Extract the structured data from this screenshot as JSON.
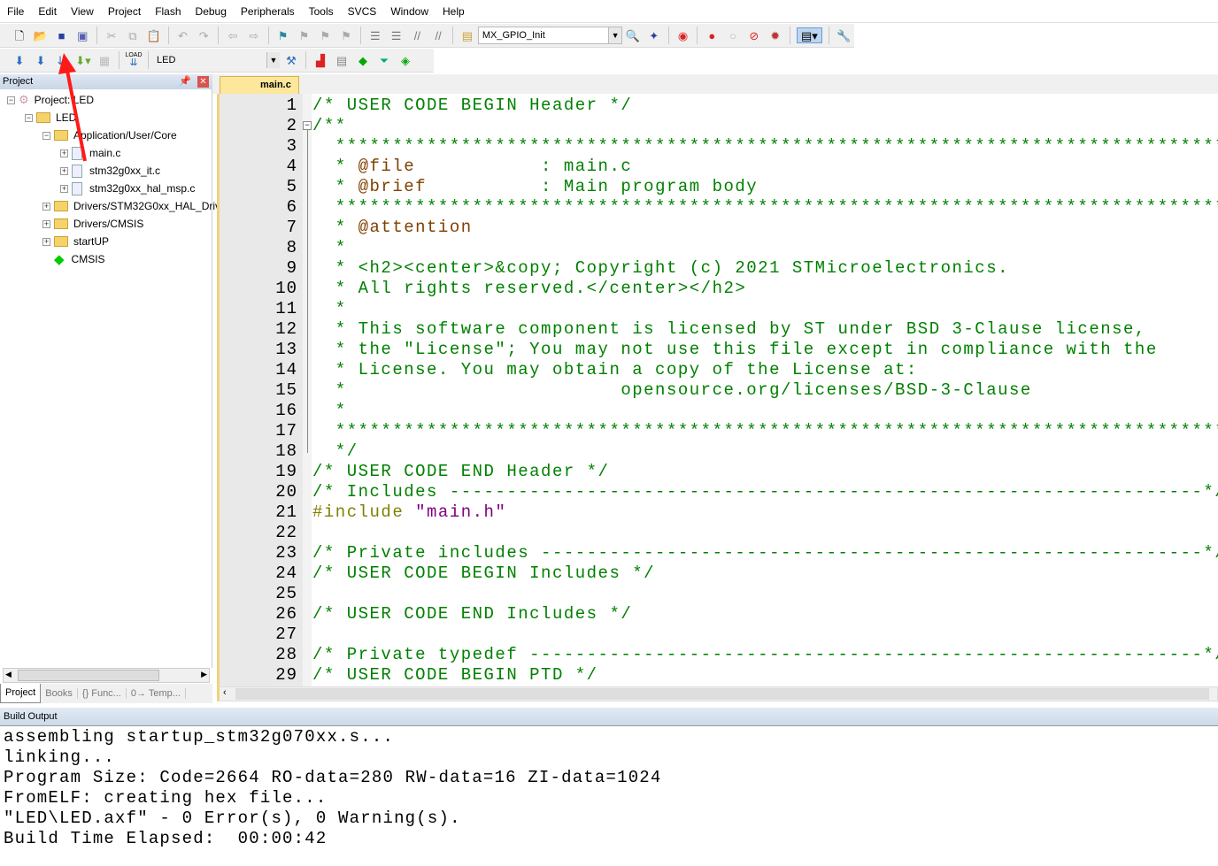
{
  "menu": [
    "File",
    "Edit",
    "View",
    "Project",
    "Flash",
    "Debug",
    "Peripherals",
    "Tools",
    "SVCS",
    "Window",
    "Help"
  ],
  "toolbar1": {
    "target_function": "MX_GPIO_Init"
  },
  "toolbar2": {
    "target_name": "LED",
    "load_label": "LOAD"
  },
  "project_panel": {
    "title": "Project",
    "tree": [
      {
        "label": "Project: LED",
        "level": 0,
        "type": "project",
        "toggle": "−"
      },
      {
        "label": "LED",
        "level": 1,
        "type": "target",
        "toggle": "−"
      },
      {
        "label": "Application/User/Core",
        "level": 2,
        "type": "folder",
        "toggle": "−"
      },
      {
        "label": "main.c",
        "level": 3,
        "type": "file",
        "toggle": "+"
      },
      {
        "label": "stm32g0xx_it.c",
        "level": 3,
        "type": "file",
        "toggle": "+"
      },
      {
        "label": "stm32g0xx_hal_msp.c",
        "level": 3,
        "type": "file",
        "toggle": "+"
      },
      {
        "label": "Drivers/STM32G0xx_HAL_Driver",
        "level": 2,
        "type": "folder",
        "toggle": "+"
      },
      {
        "label": "Drivers/CMSIS",
        "level": 2,
        "type": "folder",
        "toggle": "+"
      },
      {
        "label": "startUP",
        "level": 2,
        "type": "folder",
        "toggle": "+"
      },
      {
        "label": "CMSIS",
        "level": 2,
        "type": "component",
        "toggle": ""
      }
    ],
    "tabs": [
      "Project",
      "Books",
      "{} Func...",
      "0→ Temp..."
    ]
  },
  "editor": {
    "tab": "main.c",
    "lines": [
      [
        [
          "cm",
          "/* USER CODE BEGIN Header */"
        ]
      ],
      [
        [
          "cm",
          "/**"
        ]
      ],
      [
        [
          "cm",
          "  ******************************************************************************"
        ]
      ],
      [
        [
          "cm",
          "  * "
        ],
        [
          "tag",
          "@file"
        ],
        [
          "cm",
          "           : main.c"
        ]
      ],
      [
        [
          "cm",
          "  * "
        ],
        [
          "tag",
          "@brief"
        ],
        [
          "cm",
          "          : Main program body"
        ]
      ],
      [
        [
          "cm",
          "  ******************************************************************************"
        ]
      ],
      [
        [
          "cm",
          "  * "
        ],
        [
          "tag",
          "@attention"
        ]
      ],
      [
        [
          "cm",
          "  *"
        ]
      ],
      [
        [
          "cm",
          "  * <h2><center>&copy; Copyright (c) 2021 STMicroelectronics."
        ]
      ],
      [
        [
          "cm",
          "  * All rights reserved.</center></h2>"
        ]
      ],
      [
        [
          "cm",
          "  *"
        ]
      ],
      [
        [
          "cm",
          "  * This software component is licensed by ST under BSD 3-Clause license,"
        ]
      ],
      [
        [
          "cm",
          "  * the \"License\"; You may not use this file except in compliance with the"
        ]
      ],
      [
        [
          "cm",
          "  * License. You may obtain a copy of the License at:"
        ]
      ],
      [
        [
          "cm",
          "  *                        opensource.org/licenses/BSD-3-Clause"
        ]
      ],
      [
        [
          "cm",
          "  *"
        ]
      ],
      [
        [
          "cm",
          "  ******************************************************************************"
        ]
      ],
      [
        [
          "cm",
          "  */"
        ]
      ],
      [
        [
          "cm",
          "/* USER CODE END Header */"
        ]
      ],
      [
        [
          "cm",
          "/* Includes ------------------------------------------------------------------*/"
        ]
      ],
      [
        [
          "pp",
          "#include "
        ],
        [
          "str",
          "\"main.h\""
        ]
      ],
      [],
      [
        [
          "cm",
          "/* Private includes ----------------------------------------------------------*/"
        ]
      ],
      [
        [
          "cm",
          "/* USER CODE BEGIN Includes */"
        ]
      ],
      [],
      [
        [
          "cm",
          "/* USER CODE END Includes */"
        ]
      ],
      [],
      [
        [
          "cm",
          "/* Private typedef -----------------------------------------------------------*/"
        ]
      ],
      [
        [
          "cm",
          "/* USER CODE BEGIN PTD */"
        ]
      ]
    ]
  },
  "build_output": {
    "title": "Build Output",
    "lines": [
      "assembling startup_stm32g070xx.s...",
      "linking...",
      "Program Size: Code=2664 RO-data=280 RW-data=16 ZI-data=1024",
      "FromELF: creating hex file...",
      "\"LED\\LED.axf\" - 0 Error(s), 0 Warning(s).",
      "Build Time Elapsed:  00:00:42"
    ]
  },
  "colors": {
    "comment": "#008000",
    "doc_tag": "#804000",
    "preprocessor": "#808000",
    "string": "#800080",
    "annotation_arrow": "#ff1a1a"
  }
}
